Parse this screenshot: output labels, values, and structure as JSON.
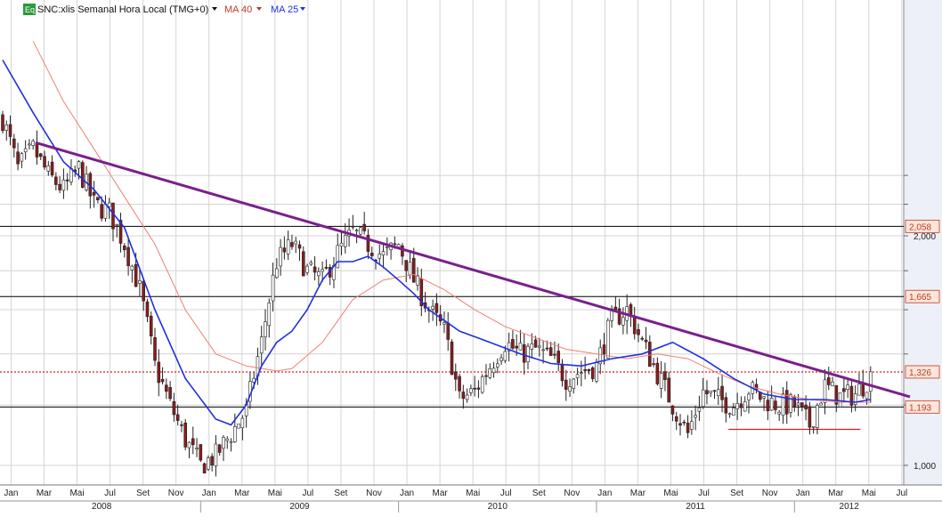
{
  "header": {
    "badge": "Eq",
    "symbol": "SNC:xlis Semanal Hora Local (TMG+0)",
    "ma40_label": "MA 40",
    "ma25_label": "MA 25"
  },
  "colors": {
    "background": "#ffffff",
    "grid": "#d4d4d4",
    "axis_bg": "#eef0f8",
    "candle_up": "#ffffff",
    "candle_down": "#8a1c1c",
    "candle_outline": "#222222",
    "ma25": "#1f2fe0",
    "ma40": "#f07f75",
    "trendline": "#7a1f8c",
    "support": "#d02020",
    "hline": "#000000",
    "tag_bg": "#fde6d8",
    "tag_text": "#c0392b",
    "badge_bg": "#2a9a3a"
  },
  "chart_data": {
    "type": "candlestick",
    "scale": "log",
    "y_range": [
      0.95,
      2.5
    ],
    "y_ticks": [
      "2,000",
      "1,000"
    ],
    "x_month_ticks": [
      "Jan",
      "Mar",
      "Mai",
      "Jul",
      "Set",
      "Nov",
      "Jan",
      "Mar",
      "Mai",
      "Jul",
      "Set",
      "Nov",
      "Jan",
      "Mar",
      "Mai",
      "Jul",
      "Set",
      "Nov",
      "Jan",
      "Mar",
      "Mai",
      "Jul",
      "Set",
      "Nov",
      "Jan",
      "Mar",
      "Mai",
      "Jul"
    ],
    "x_years": [
      "2008",
      "2009",
      "2010",
      "2011",
      "2012"
    ],
    "price_levels": [
      {
        "value": 2.058,
        "label": "2,058"
      },
      {
        "value": 1.665,
        "label": "1,665"
      },
      {
        "value": 1.326,
        "label": "1,326"
      },
      {
        "value": 1.193,
        "label": "1,193"
      }
    ],
    "dotted_level": 1.326,
    "support_segment": {
      "from": "2011-09",
      "to": "2012-05",
      "value": 1.115
    },
    "trendline": [
      {
        "date": "2008-03",
        "value": 2.65
      },
      {
        "date": "2012-08",
        "value": 1.23
      }
    ],
    "close_path": [
      {
        "t": 0,
        "v": 2.85
      },
      {
        "t": 4,
        "v": 2.45
      },
      {
        "t": 8,
        "v": 2.6
      },
      {
        "t": 12,
        "v": 2.4
      },
      {
        "t": 16,
        "v": 2.3
      },
      {
        "t": 20,
        "v": 2.45
      },
      {
        "t": 24,
        "v": 2.2
      },
      {
        "t": 28,
        "v": 2.15
      },
      {
        "t": 32,
        "v": 1.95
      },
      {
        "t": 36,
        "v": 1.7
      },
      {
        "t": 40,
        "v": 1.35
      },
      {
        "t": 44,
        "v": 1.2
      },
      {
        "t": 48,
        "v": 1.08
      },
      {
        "t": 52,
        "v": 1.0
      },
      {
        "t": 56,
        "v": 1.03
      },
      {
        "t": 60,
        "v": 1.1
      },
      {
        "t": 64,
        "v": 1.18
      },
      {
        "t": 68,
        "v": 1.45
      },
      {
        "t": 72,
        "v": 1.85
      },
      {
        "t": 76,
        "v": 1.95
      },
      {
        "t": 80,
        "v": 1.8
      },
      {
        "t": 84,
        "v": 1.75
      },
      {
        "t": 88,
        "v": 1.9
      },
      {
        "t": 92,
        "v": 2.02
      },
      {
        "t": 96,
        "v": 1.95
      },
      {
        "t": 100,
        "v": 1.88
      },
      {
        "t": 104,
        "v": 1.95
      },
      {
        "t": 108,
        "v": 1.75
      },
      {
        "t": 112,
        "v": 1.6
      },
      {
        "t": 116,
        "v": 1.5
      },
      {
        "t": 120,
        "v": 1.22
      },
      {
        "t": 124,
        "v": 1.25
      },
      {
        "t": 128,
        "v": 1.35
      },
      {
        "t": 132,
        "v": 1.45
      },
      {
        "t": 136,
        "v": 1.4
      },
      {
        "t": 140,
        "v": 1.42
      },
      {
        "t": 144,
        "v": 1.38
      },
      {
        "t": 148,
        "v": 1.3
      },
      {
        "t": 152,
        "v": 1.33
      },
      {
        "t": 156,
        "v": 1.35
      },
      {
        "t": 160,
        "v": 1.55
      },
      {
        "t": 164,
        "v": 1.6
      },
      {
        "t": 168,
        "v": 1.45
      },
      {
        "t": 172,
        "v": 1.32
      },
      {
        "t": 176,
        "v": 1.2
      },
      {
        "t": 180,
        "v": 1.1
      },
      {
        "t": 184,
        "v": 1.25
      },
      {
        "t": 188,
        "v": 1.22
      },
      {
        "t": 192,
        "v": 1.2
      },
      {
        "t": 196,
        "v": 1.26
      },
      {
        "t": 200,
        "v": 1.22
      },
      {
        "t": 204,
        "v": 1.2
      },
      {
        "t": 208,
        "v": 1.2
      },
      {
        "t": 212,
        "v": 1.13
      },
      {
        "t": 216,
        "v": 1.27
      },
      {
        "t": 220,
        "v": 1.23
      },
      {
        "t": 224,
        "v": 1.24
      },
      {
        "t": 228,
        "v": 1.31
      }
    ],
    "ma25_path": [
      {
        "t": 0,
        "v": 3.4
      },
      {
        "t": 8,
        "v": 2.9
      },
      {
        "t": 16,
        "v": 2.5
      },
      {
        "t": 24,
        "v": 2.3
      },
      {
        "t": 32,
        "v": 2.05
      },
      {
        "t": 40,
        "v": 1.6
      },
      {
        "t": 48,
        "v": 1.3
      },
      {
        "t": 56,
        "v": 1.15
      },
      {
        "t": 60,
        "v": 1.13
      },
      {
        "t": 64,
        "v": 1.2
      },
      {
        "t": 68,
        "v": 1.35
      },
      {
        "t": 72,
        "v": 1.45
      },
      {
        "t": 76,
        "v": 1.5
      },
      {
        "t": 80,
        "v": 1.6
      },
      {
        "t": 84,
        "v": 1.75
      },
      {
        "t": 88,
        "v": 1.85
      },
      {
        "t": 92,
        "v": 1.85
      },
      {
        "t": 96,
        "v": 1.88
      },
      {
        "t": 100,
        "v": 1.82
      },
      {
        "t": 104,
        "v": 1.75
      },
      {
        "t": 108,
        "v": 1.68
      },
      {
        "t": 112,
        "v": 1.6
      },
      {
        "t": 120,
        "v": 1.5
      },
      {
        "t": 128,
        "v": 1.45
      },
      {
        "t": 136,
        "v": 1.4
      },
      {
        "t": 144,
        "v": 1.36
      },
      {
        "t": 152,
        "v": 1.35
      },
      {
        "t": 160,
        "v": 1.38
      },
      {
        "t": 168,
        "v": 1.4
      },
      {
        "t": 176,
        "v": 1.45
      },
      {
        "t": 184,
        "v": 1.38
      },
      {
        "t": 192,
        "v": 1.3
      },
      {
        "t": 200,
        "v": 1.24
      },
      {
        "t": 208,
        "v": 1.22
      },
      {
        "t": 216,
        "v": 1.22
      },
      {
        "t": 224,
        "v": 1.21
      },
      {
        "t": 228,
        "v": 1.22
      }
    ],
    "ma40_path": [
      {
        "t": 8,
        "v": 3.6
      },
      {
        "t": 16,
        "v": 3.0
      },
      {
        "t": 24,
        "v": 2.6
      },
      {
        "t": 32,
        "v": 2.25
      },
      {
        "t": 40,
        "v": 1.95
      },
      {
        "t": 48,
        "v": 1.6
      },
      {
        "t": 56,
        "v": 1.4
      },
      {
        "t": 64,
        "v": 1.35
      },
      {
        "t": 72,
        "v": 1.33
      },
      {
        "t": 76,
        "v": 1.34
      },
      {
        "t": 84,
        "v": 1.45
      },
      {
        "t": 92,
        "v": 1.65
      },
      {
        "t": 100,
        "v": 1.75
      },
      {
        "t": 108,
        "v": 1.78
      },
      {
        "t": 116,
        "v": 1.7
      },
      {
        "t": 124,
        "v": 1.6
      },
      {
        "t": 132,
        "v": 1.52
      },
      {
        "t": 140,
        "v": 1.47
      },
      {
        "t": 148,
        "v": 1.42
      },
      {
        "t": 156,
        "v": 1.4
      },
      {
        "t": 164,
        "v": 1.38
      },
      {
        "t": 172,
        "v": 1.4
      },
      {
        "t": 180,
        "v": 1.38
      },
      {
        "t": 188,
        "v": 1.32
      },
      {
        "t": 196,
        "v": 1.27
      },
      {
        "t": 204,
        "v": 1.24
      },
      {
        "t": 212,
        "v": 1.22
      },
      {
        "t": 220,
        "v": 1.21
      },
      {
        "t": 228,
        "v": 1.21
      }
    ]
  }
}
